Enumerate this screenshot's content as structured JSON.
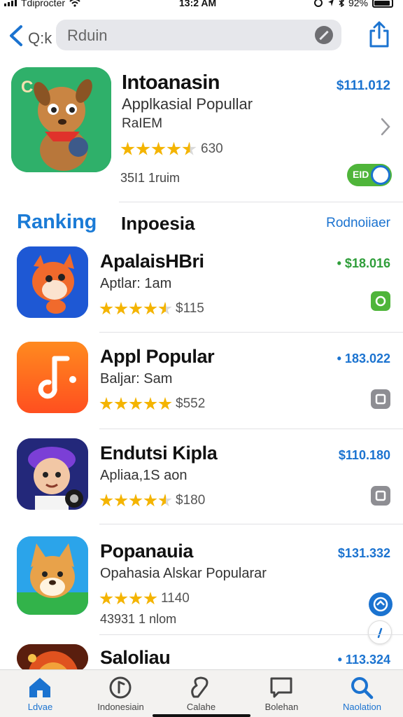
{
  "status": {
    "carrier": "Tdiprocter",
    "time": "13:2 AM",
    "battery": "92%"
  },
  "nav": {
    "back_label": "Q:k",
    "search_text": "Rduin"
  },
  "featured": {
    "title": "Intoanasin",
    "subtitle": "Applkasial Popullar",
    "developer": "RaIEM",
    "rating_value": "630",
    "stars": 4.5,
    "size": "35I1 1ruim",
    "price": "$111.012",
    "toggle_label": "EID"
  },
  "ranking": {
    "title": "Ranking",
    "subtitle": "Inpoesia",
    "link": "Rodnoiiaer"
  },
  "apps": [
    {
      "name": "ApalaisHBri",
      "category": "Aptlar: 1am",
      "stars": 4.5,
      "rating": "$115",
      "extra": "",
      "price": "• $18.016",
      "price_color": "#2f9e3a",
      "action": "green"
    },
    {
      "name": "Appl Popular",
      "category": "Baljar: Sam",
      "stars": 5,
      "rating": "$552",
      "extra": "",
      "price": "• 183.022",
      "price_color": "#1b73d0",
      "action": "gray"
    },
    {
      "name": "Endutsi  Kipla",
      "category": "Apliaa,1S aon",
      "stars": 4.5,
      "rating": "$180",
      "extra": "",
      "price": "$110.180",
      "price_color": "#1b73d0",
      "action": "gray"
    },
    {
      "name": "Popanauia",
      "category": "Opahasia Alskar Popularar",
      "stars": 4,
      "rating": "1140",
      "extra": "43931 1 nlom",
      "price": "$131.332",
      "price_color": "#1b73d0",
      "action": "circle"
    },
    {
      "name": "Saloliau",
      "category": "",
      "stars": 0,
      "rating": "",
      "extra": "",
      "price": "• 113.324",
      "price_color": "#1b73d0",
      "action": "none"
    }
  ],
  "tabs": [
    {
      "label": "Ldvae",
      "icon": "home-icon",
      "active": true
    },
    {
      "label": "Indonesiain",
      "icon": "games-icon",
      "active": false
    },
    {
      "label": "Calahe",
      "icon": "apps-icon",
      "active": false
    },
    {
      "label": "Bolehan",
      "icon": "chat-icon",
      "active": false
    },
    {
      "label": "Naolation",
      "icon": "search-icon",
      "active": true
    }
  ],
  "colors": {
    "accent": "#1b73d0",
    "star": "#f4b400",
    "green": "#4fb53a"
  }
}
